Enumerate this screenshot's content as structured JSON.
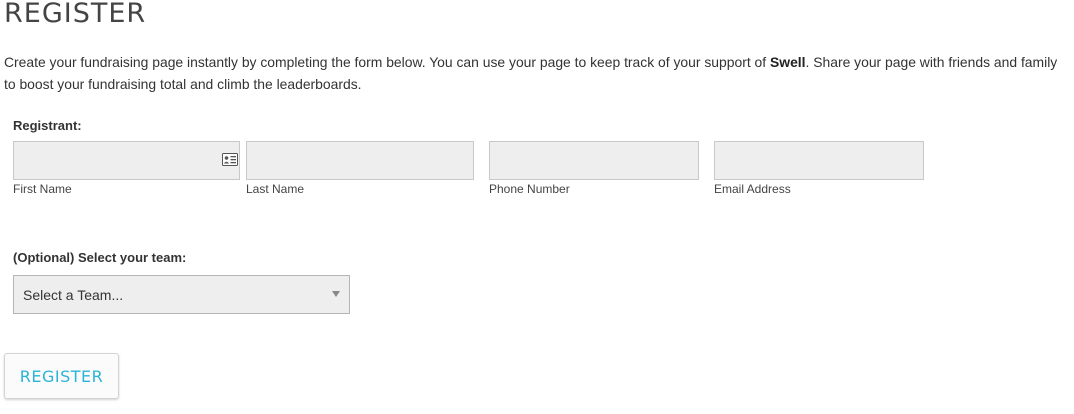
{
  "page": {
    "title": "REGISTER",
    "intro_before": "Create your fundraising page instantly by completing the form below. You can use your page to keep track of your support of ",
    "intro_bold": "Swell",
    "intro_after": ". Share your page with friends and family to boost your fundraising total and climb the leaderboards."
  },
  "registrant": {
    "label": "Registrant:",
    "first_name": {
      "label": "First Name",
      "value": ""
    },
    "last_name": {
      "label": "Last Name",
      "value": ""
    },
    "phone": {
      "label": "Phone Number",
      "value": ""
    },
    "email": {
      "label": "Email Address",
      "value": ""
    }
  },
  "team": {
    "label": "(Optional) Select your team:",
    "selected": "Select a Team..."
  },
  "actions": {
    "register_label": "REGISTER"
  },
  "colors": {
    "accent": "#2bb3d9",
    "field_bg": "#eeeeee",
    "field_border": "#c8c8c8"
  },
  "icons": {
    "autofill": "contact-card-icon",
    "dropdown": "caret-down-icon"
  }
}
